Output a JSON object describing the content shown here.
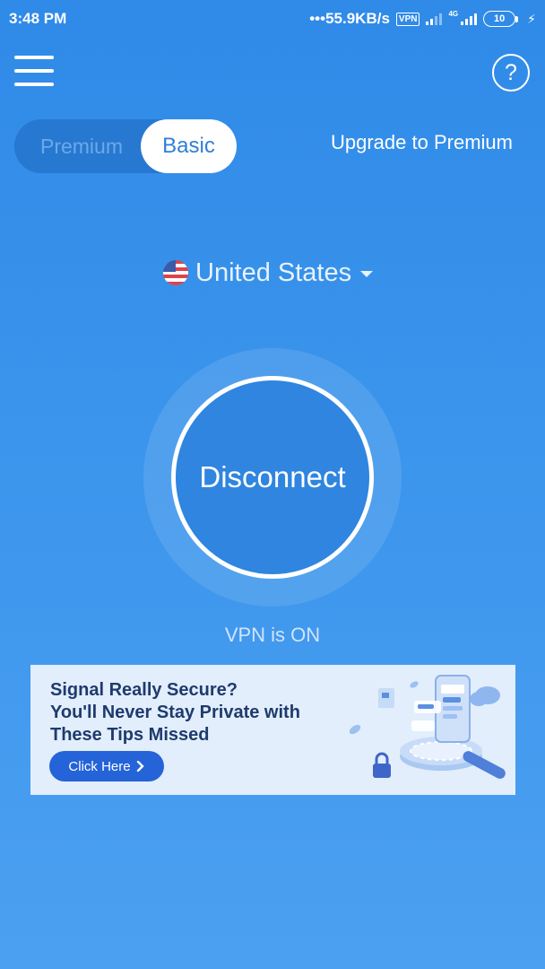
{
  "status_bar": {
    "time": "3:48 PM",
    "network_speed": "•••55.9KB/s",
    "vpn_badge": "VPN",
    "network_type": "4G",
    "battery": "10"
  },
  "header": {
    "help_symbol": "?"
  },
  "plan_toggle": {
    "premium_label": "Premium",
    "basic_label": "Basic",
    "selected": "Basic"
  },
  "upgrade_label": "Upgrade to Premium",
  "location": {
    "country": "United States"
  },
  "connection": {
    "button_label": "Disconnect",
    "status_text": "VPN is ON"
  },
  "ad": {
    "line1": "Signal Really Secure?",
    "line2": "You'll Never Stay Private with",
    "line3": "These Tips Missed",
    "cta_label": "Click Here"
  },
  "colors": {
    "background_top": "#2f8ae8",
    "background_bottom": "#4ca0f1",
    "toggle_track": "#2778d0",
    "button_fill": "#2f85e0",
    "ad_background": "#e2eefb",
    "ad_cta": "#2563d9"
  },
  "icons": {
    "menu": "hamburger-icon",
    "help": "question-circle-icon",
    "flag": "us-flag-icon",
    "caret": "caret-down-icon",
    "cta_arrow": "chevron-right-icon"
  }
}
